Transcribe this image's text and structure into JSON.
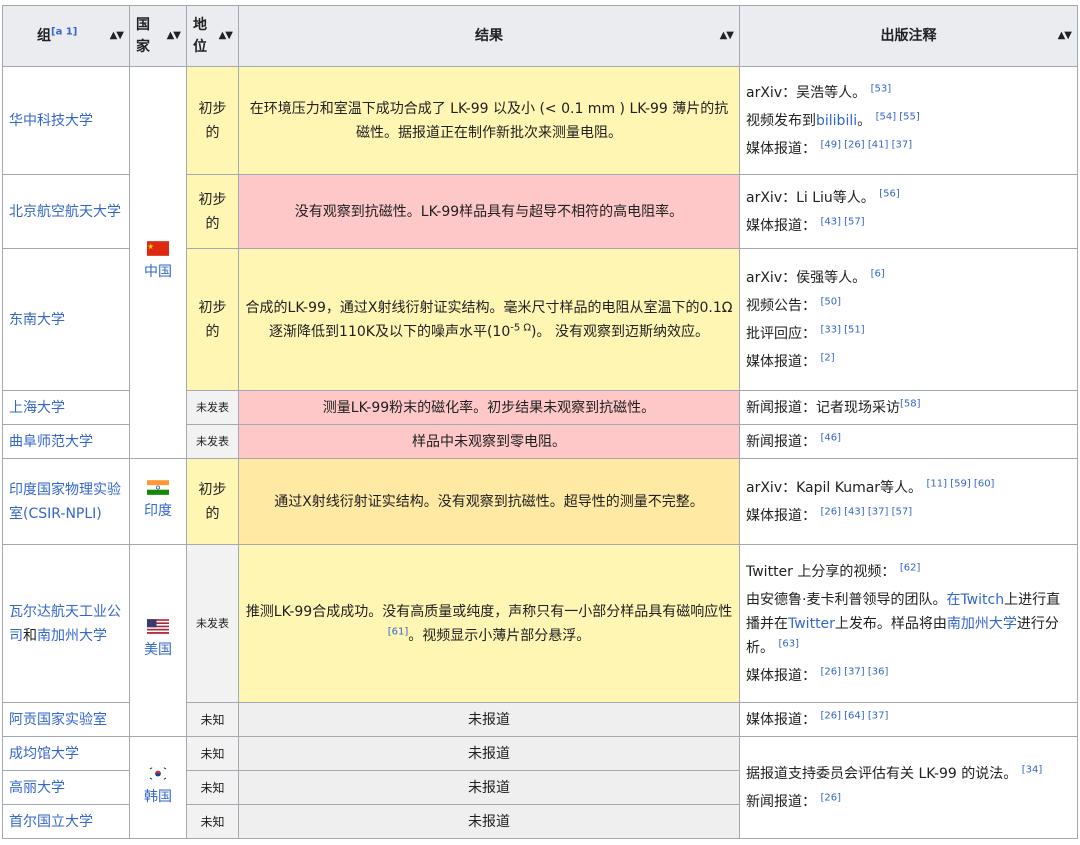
{
  "headers": {
    "group": "组",
    "group_note": "[a 1]",
    "country": "国家",
    "status": "地位",
    "result": "结果",
    "publication": "出版注释"
  },
  "rows": [
    {
      "org": "华中科技大学",
      "status": "初步的",
      "result_pre": "在环境压力和室温下成功合成了 LK-99 以及小 (< 0.1 mm ) LK-99 薄片的抗磁性。据报道正在制作新批次来测量电阻。",
      "pub": [
        {
          "text": "arXiv：吴浩等人。",
          "refs": "[53]"
        },
        {
          "text_pre": "视频发布到",
          "link": "bilibili",
          "text_post": "。",
          "refs": "[54] [55]"
        },
        {
          "text": "媒体报道：",
          "refs": "[49] [26] [41] [37]"
        }
      ]
    },
    {
      "org": "北京航空航天大学",
      "status": "初步的",
      "result_pre": "没有观察到抗磁性。LK-99样品具有与超导不相符的高电阻率。",
      "pub": [
        {
          "text": "arXiv：Li Liu等人。",
          "refs": "[56]"
        },
        {
          "text": "媒体报道：",
          "refs": "[43] [57]"
        }
      ]
    },
    {
      "org": "东南大学",
      "status": "初步的",
      "result_pre": "合成的LK-99，通过X射线衍射证实结构。毫米尺寸样品的电阻从室温下的0.1Ω逐渐降低到110K及以下的噪声水平(10",
      "result_sup": "-5 Ω",
      "result_post": ")。 没有观察到迈斯纳效应。",
      "pub": [
        {
          "text": "arXiv：侯强等人。",
          "refs": "[6]"
        },
        {
          "text": "视频公告：",
          "refs": "[50]"
        },
        {
          "text": "批评回应：",
          "refs": "[33] [51]"
        },
        {
          "text": "媒体报道：",
          "refs": "[2]"
        }
      ]
    },
    {
      "org": "上海大学",
      "status": "未发表",
      "result_pre": "测量LK-99粉末的磁化率。初步结果未观察到抗磁性。",
      "pub": [
        {
          "text": "新闻报道：记者现场采访",
          "refs": "[58]"
        }
      ]
    },
    {
      "org": "曲阜师范大学",
      "status": "未发表",
      "result_pre": "样品中未观察到零电阻。",
      "pub": [
        {
          "text": "新闻报道：",
          "refs": "[46]"
        }
      ]
    },
    {
      "org": "印度国家物理实验室(CSIR-NPLI)",
      "status": "初步的",
      "result_pre": "通过X射线衍射证实结构。没有观察到抗磁性。超导性的测量不完整。",
      "pub": [
        {
          "text": "arXiv：Kapil Kumar等人。",
          "refs": "[11] [59] [60]"
        },
        {
          "text": "媒体报道：",
          "refs": "[26] [43] [37] [57]"
        }
      ]
    },
    {
      "org_a": "瓦尔达航天工业公司",
      "org_mid": "和",
      "org_b": "南加州大学",
      "status": "未发表",
      "result_pre": "推测LK-99合成成功。没有高质量或纯度，声称只有一小部分样品具有磁响应性",
      "result_ref": "[61]",
      "result_post": "。视频显示小薄片部分悬浮。",
      "pub": [
        {
          "text": "Twitter 上分享的视频：",
          "refs": "[62]"
        },
        {
          "complex": true,
          "p1": "由安德鲁·麦卡利普领导的团队。",
          "l1": "在Twitch",
          "p2": "上进行直播并在",
          "l2": "Twitter",
          "p3": "上发布。样品将由",
          "l3": "南加州大学",
          "p4": "进行分析。",
          "refs": "[63]"
        },
        {
          "text": "媒体报道：",
          "refs": "[26] [37] [36]"
        }
      ]
    },
    {
      "org": "阿贡国家实验室",
      "status": "未知",
      "result_pre": "未报道",
      "pub": [
        {
          "text": "媒体报道：",
          "refs": "[26] [64] [37]"
        }
      ]
    },
    {
      "org": "成均馆大学",
      "status": "未知",
      "result_pre": "未报道"
    },
    {
      "org": "高丽大学",
      "status": "未知",
      "result_pre": "未报道"
    },
    {
      "org": "首尔国立大学",
      "status": "未知",
      "result_pre": "未报道"
    }
  ],
  "countries": {
    "china": "中国",
    "india": "印度",
    "usa": "美国",
    "korea": "韩国"
  },
  "korea_pub": [
    {
      "text": "据报道支持委员会评估有关 LK-99 的说法。",
      "refs": "[34]"
    },
    {
      "text": "新闻报道：",
      "refs": "[26]"
    }
  ],
  "colors": {
    "header_bg": "#eaecf0",
    "link": "#3366cc",
    "yellow": "#fff6b4",
    "red": "#ffc8c8",
    "orange": "#ffe9a3",
    "gray": "#efefef"
  },
  "icons": {
    "sort": "sort-arrows-icon",
    "flags": [
      "china-flag-icon",
      "india-flag-icon",
      "usa-flag-icon",
      "korea-flag-icon"
    ]
  }
}
